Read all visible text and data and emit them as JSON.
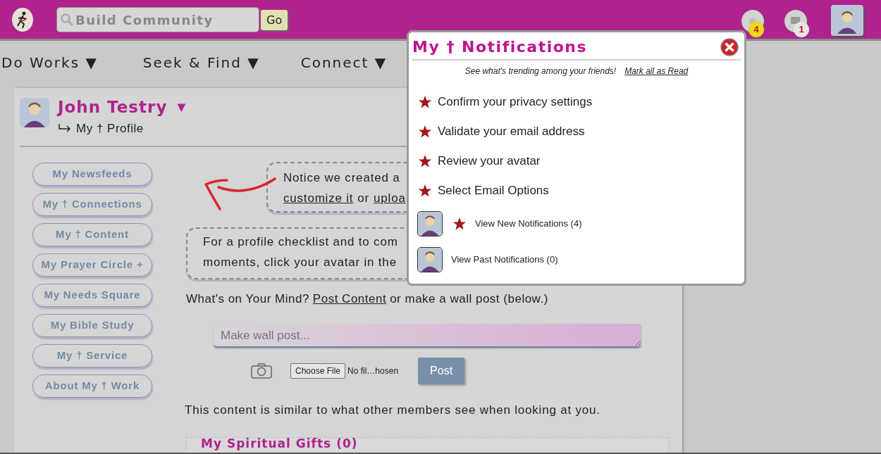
{
  "header": {
    "search": {
      "placeholder": "Build Community"
    },
    "go_button": "Go",
    "notification_count": "4",
    "message_count": "1"
  },
  "nav": [
    {
      "label": "Do Works ▼"
    },
    {
      "label": "Seek & Find ▼"
    },
    {
      "label": "Connect ▼"
    }
  ],
  "profile": {
    "name": "John Testry",
    "caret": "▼",
    "link": "My † Profile"
  },
  "sidebar": {
    "items": [
      {
        "label": "My Newsfeeds"
      },
      {
        "label": "My † Connections"
      },
      {
        "label": "My † Content"
      },
      {
        "label": "My Prayer Circle +"
      },
      {
        "label": "My Needs Square"
      },
      {
        "label": "My Bible Study"
      },
      {
        "label": "My † Service"
      },
      {
        "label": "About My † Work"
      }
    ]
  },
  "notice_1": {
    "text": "Notice we created a",
    "link_1": "customize it",
    "middle": "or",
    "link_2": "uploa"
  },
  "notice_2": {
    "lines": [
      "For a profile checklist and to com",
      "moments, click your avatar in the"
    ]
  },
  "post": {
    "prompt": "What's on Your Mind?",
    "link": "Post Content",
    "prompt_after": "or make a wall post (below.)",
    "placeholder": "Make wall post...",
    "file_button": "Choose File",
    "file_status": "No fil…hosen",
    "submit": "Post"
  },
  "visibility_note": "This content is similar to what other members see when looking at you.",
  "section_title": "My Spiritual Gifts (0)",
  "notifications": {
    "title": "My † Notifications",
    "subtitle": "See what's trending among your friends!",
    "mark_all": "Mark all as Read",
    "items": [
      {
        "kind": "task",
        "label": "Confirm your privacy settings"
      },
      {
        "kind": "task",
        "label": "Validate your email address"
      },
      {
        "kind": "task",
        "label": "Review your avatar"
      },
      {
        "kind": "task",
        "label": "Select Email Options"
      },
      {
        "kind": "avatar",
        "label": "View New Notifications (4)",
        "starred": true
      },
      {
        "kind": "avatar",
        "label": "View Past Notifications (0)",
        "starred": false
      }
    ]
  }
}
